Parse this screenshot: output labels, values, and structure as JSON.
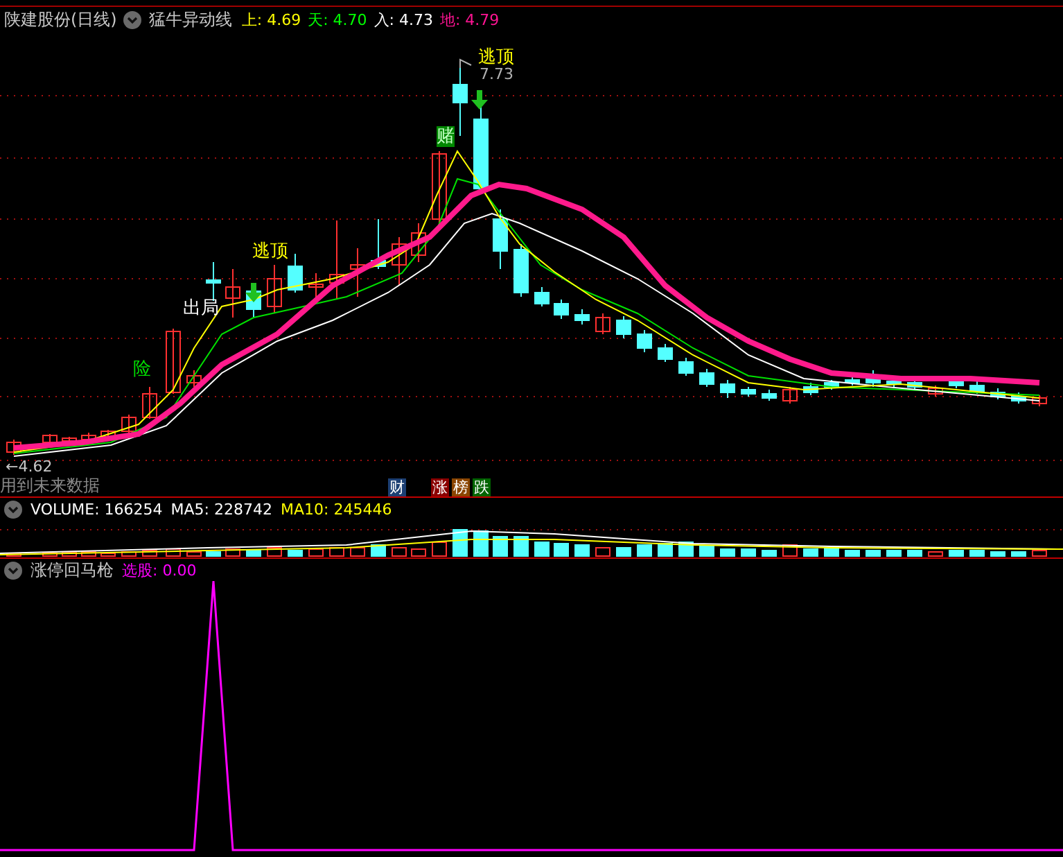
{
  "chart_header": {
    "stock": "陕建股份(日线)",
    "indicator": "猛牛异动线",
    "readings": [
      {
        "text": "上: 4.69",
        "color": "#ffff00"
      },
      {
        "text": "天: 4.70",
        "color": "#00ff00"
      },
      {
        "text": "入: 4.73",
        "color": "#ffffff"
      },
      {
        "text": "地: 4.79",
        "color": "#ff1493"
      }
    ]
  },
  "price_chart": {
    "signals": [
      {
        "text": "险",
        "kind": "warning"
      },
      {
        "text": "出局",
        "kind": "exit"
      },
      {
        "text": "逃顶",
        "kind": "top"
      },
      {
        "text": "赌",
        "kind": "bet"
      },
      {
        "text": "逃顶",
        "kind": "top"
      }
    ],
    "high_marker": "7.73",
    "low_marker": "←4.62",
    "notice": "用到未来数据",
    "badges": [
      {
        "text": "财",
        "color": "#1c3f73"
      },
      {
        "text": "涨",
        "color": "#8b0000"
      },
      {
        "text": "榜",
        "color": "#8b4500"
      },
      {
        "text": "跌",
        "color": "#006400"
      }
    ]
  },
  "volume_panel": {
    "readings": [
      {
        "text": "VOLUME: 166254",
        "color": "#ffffff"
      },
      {
        "text": "MA5: 228742",
        "color": "#ffffff"
      },
      {
        "text": "MA10: 245446",
        "color": "#ffff00"
      }
    ]
  },
  "signal_panel": {
    "title": "涨停回马枪",
    "readings": [
      {
        "text": "选股: 0.00",
        "color": "#ff00ff"
      }
    ]
  }
}
